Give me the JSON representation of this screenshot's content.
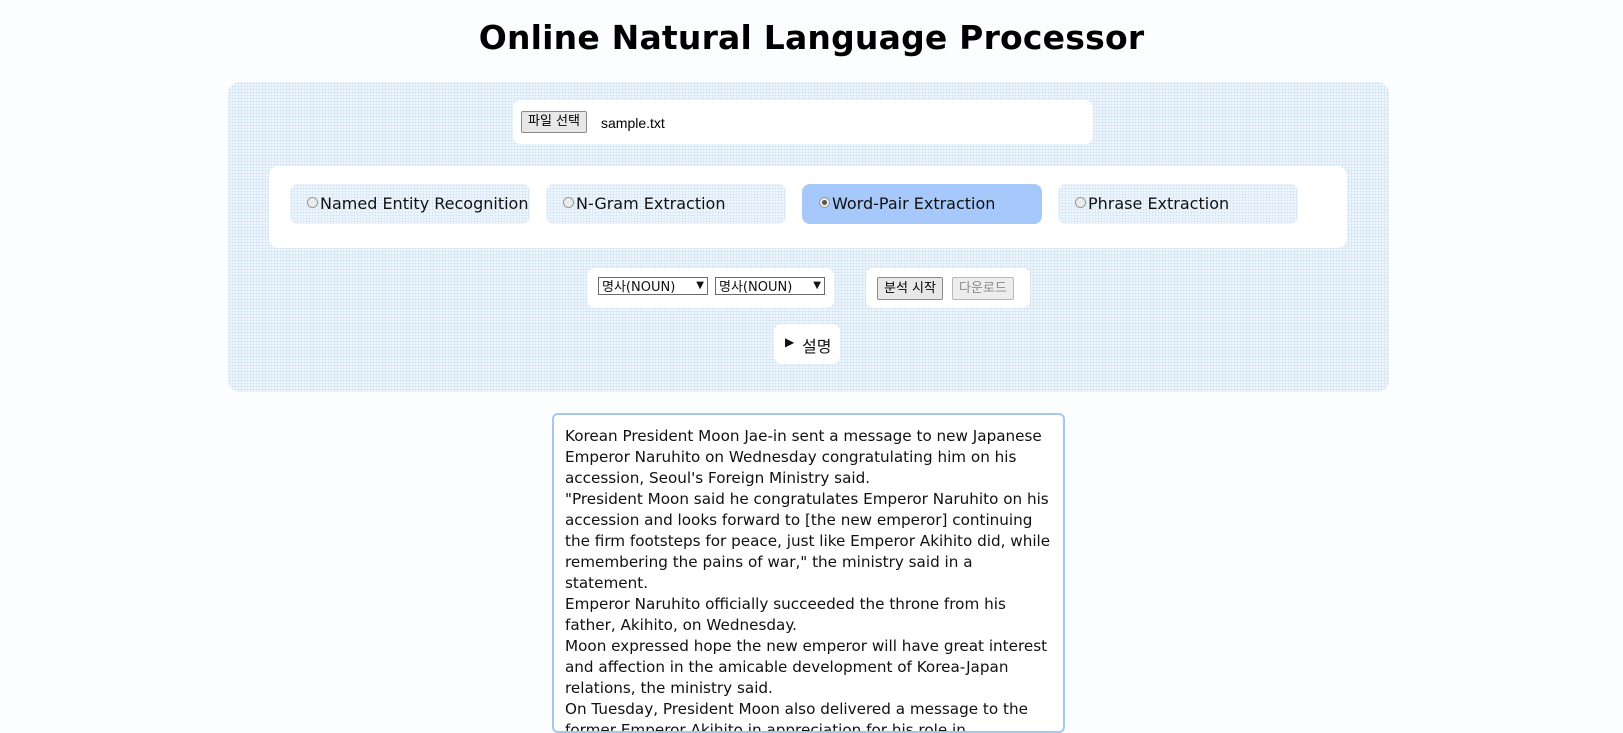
{
  "page": {
    "title": "Online Natural Language Processor"
  },
  "file": {
    "button_label": "파일 선택",
    "file_name": "sample.txt"
  },
  "options": [
    {
      "label": "Named Entity Recognition",
      "selected": false
    },
    {
      "label": "N-Gram Extraction",
      "selected": false
    },
    {
      "label": "Word-Pair Extraction",
      "selected": true
    },
    {
      "label": "Phrase Extraction",
      "selected": false
    }
  ],
  "selects": {
    "first_value": "명사(NOUN)",
    "second_value": "명사(NOUN)"
  },
  "actions": {
    "start_label": "분석 시작",
    "download_label": "다운로드"
  },
  "description": {
    "toggle_glyph": "▶",
    "label": "설명"
  },
  "text_content": {
    "paragraphs": [
      "Korean President Moon Jae-in sent a message to new Japanese Emperor Naruhito on Wednesday congratulating him on his accession, Seoul's Foreign Ministry said.",
      "\"President Moon said he congratulates Emperor Naruhito on his accession and looks forward to [the new emperor] continuing the firm footsteps for peace, just like Emperor Akihito did, while remembering the pains of war,\" the ministry said in a statement.",
      "Emperor Naruhito officially succeeded the throne from his father, Akihito, on Wednesday.",
      "Moon expressed hope the new emperor will have great interest and affection in the amicable development of Korea-Japan relations, the ministry said.",
      "On Tuesday, President Moon also delivered a message to the former Emperor Akihito in appreciation for his role in developing"
    ]
  },
  "colors": {
    "selected_option": "#a6c8fb",
    "textarea_border": "#a4c6f2",
    "panel_background": "#eef5fc"
  }
}
